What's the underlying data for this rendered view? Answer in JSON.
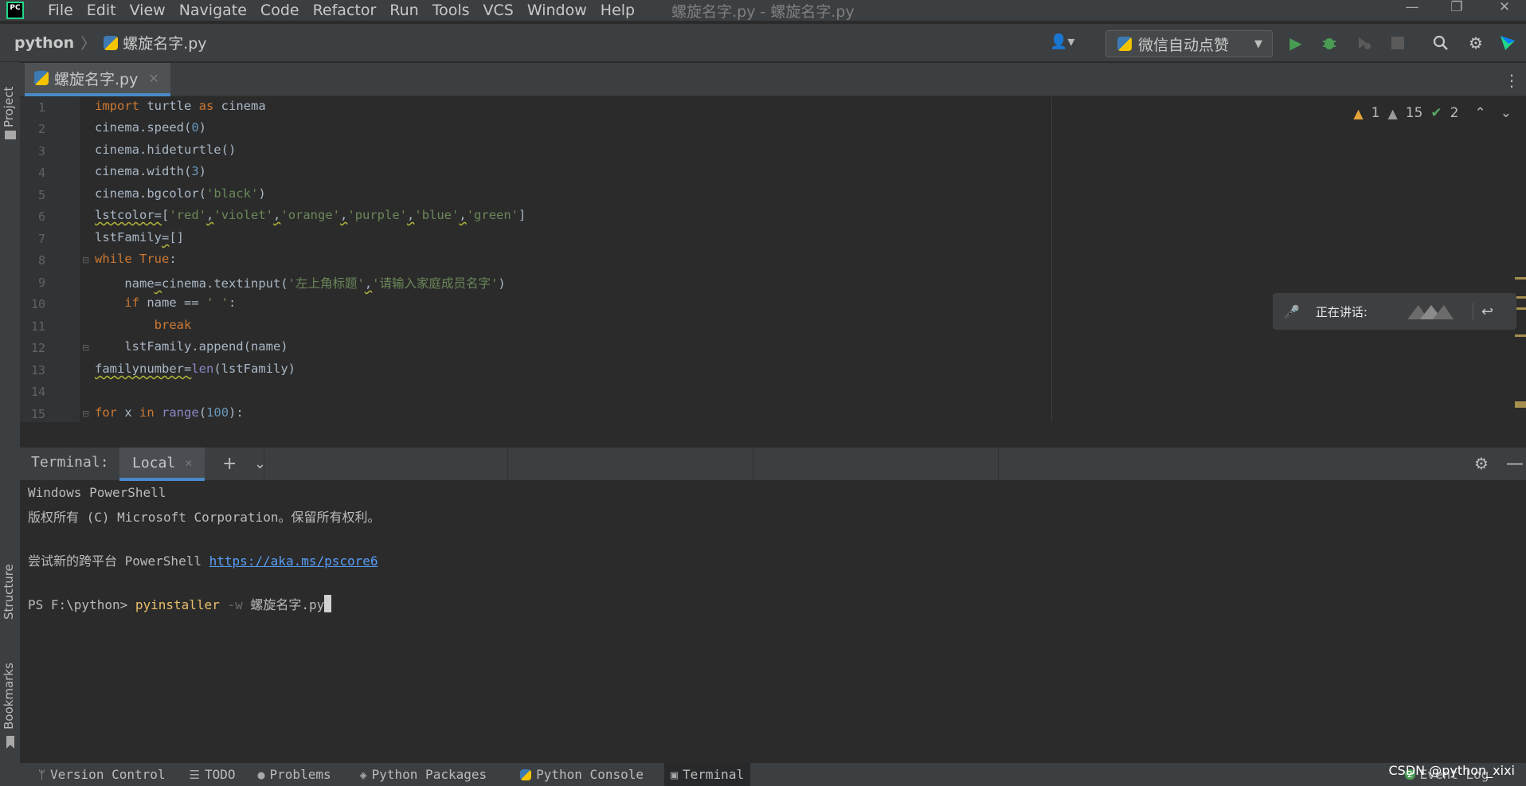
{
  "menubar": {
    "logo": "PC",
    "items": [
      "File",
      "Edit",
      "View",
      "Navigate",
      "Code",
      "Refactor",
      "Run",
      "Tools",
      "VCS",
      "Window",
      "Help"
    ],
    "window_title": "螺旋名字.py - 螺旋名字.py",
    "window_controls": [
      "—",
      "❐",
      "✕"
    ]
  },
  "navbar": {
    "project": "python",
    "separator": "〉",
    "file": "螺旋名字.py",
    "run_config": "微信自动点赞"
  },
  "left_strip": {
    "project": "Project",
    "structure": "Structure",
    "bookmarks": "Bookmarks"
  },
  "editor_tab": {
    "label": "螺旋名字.py",
    "close": "✕"
  },
  "inspections": {
    "warnings": "1",
    "weak_warnings": "15",
    "typos": "2"
  },
  "code": {
    "line_numbers": [
      "1",
      "2",
      "3",
      "4",
      "5",
      "6",
      "7",
      "8",
      "9",
      "10",
      "11",
      "12",
      "13",
      "14",
      "15"
    ]
  },
  "speaking_popup": {
    "label": "正在讲话:"
  },
  "terminal": {
    "title": "Terminal:",
    "tab": "Local",
    "close": "✕",
    "line1": "Windows PowerShell",
    "line2": "版权所有 (C) Microsoft Corporation。保留所有权利。",
    "line3_prefix": "尝试新的跨平台 PowerShell ",
    "line3_link": "https://aka.ms/pscore6",
    "prompt": "PS F:\\python> ",
    "cmd": "pyinstaller",
    "flag": " -w ",
    "arg": "螺旋名字.py"
  },
  "bottom_bar": {
    "items": [
      "Version Control",
      "TODO",
      "Problems",
      "Python Packages",
      "Python Console",
      "Terminal"
    ],
    "event_log": "Event Log",
    "event_count": "2"
  },
  "watermark": "CSDN @python_xixi",
  "colors": {
    "background": "#2b2b2b",
    "panel": "#3c3f41",
    "accent": "#4a88c7",
    "keyword": "#cc7832",
    "string": "#6a8759",
    "number": "#6897bb",
    "run_green": "#499c54"
  }
}
